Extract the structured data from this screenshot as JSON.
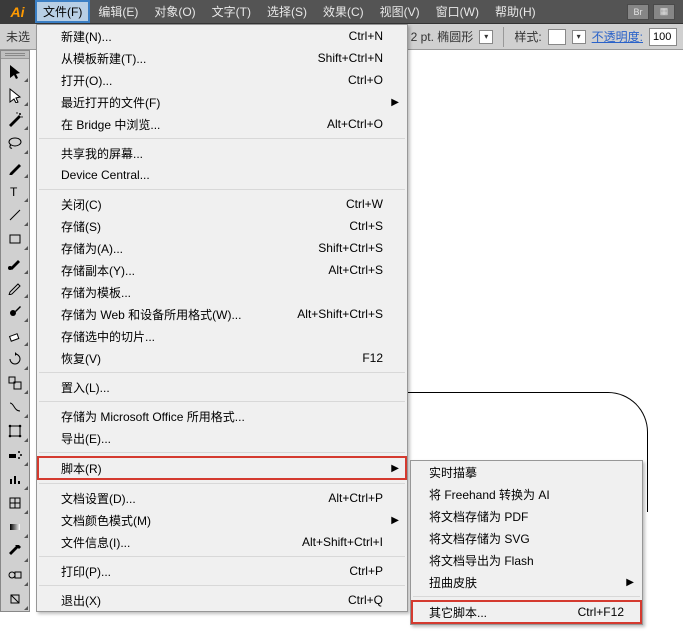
{
  "app": {
    "logo": "Ai",
    "badge1": "Br",
    "badge2": "▦"
  },
  "menubar": [
    "文件(F)",
    "编辑(E)",
    "对象(O)",
    "文字(T)",
    "选择(S)",
    "效果(C)",
    "视图(V)",
    "窗口(W)",
    "帮助(H)"
  ],
  "optbar": {
    "left_text": "未选",
    "stroke_label": "2 pt. 椭圆形",
    "style_label": "样式:",
    "opacity_label": "不透明度:",
    "opacity_value": "100"
  },
  "file_menu": [
    {
      "label": "新建(N)...",
      "shortcut": "Ctrl+N"
    },
    {
      "label": "从模板新建(T)...",
      "shortcut": "Shift+Ctrl+N"
    },
    {
      "label": "打开(O)...",
      "shortcut": "Ctrl+O"
    },
    {
      "label": "最近打开的文件(F)",
      "arrow": true
    },
    {
      "label": "在 Bridge 中浏览...",
      "shortcut": "Alt+Ctrl+O"
    },
    {
      "sep": true
    },
    {
      "label": "共享我的屏幕..."
    },
    {
      "label": "Device Central..."
    },
    {
      "sep": true
    },
    {
      "label": "关闭(C)",
      "shortcut": "Ctrl+W"
    },
    {
      "label": "存储(S)",
      "shortcut": "Ctrl+S"
    },
    {
      "label": "存储为(A)...",
      "shortcut": "Shift+Ctrl+S"
    },
    {
      "label": "存储副本(Y)...",
      "shortcut": "Alt+Ctrl+S"
    },
    {
      "label": "存储为模板..."
    },
    {
      "label": "存储为 Web 和设备所用格式(W)...",
      "shortcut": "Alt+Shift+Ctrl+S"
    },
    {
      "label": "存储选中的切片..."
    },
    {
      "label": "恢复(V)",
      "shortcut": "F12"
    },
    {
      "sep": true
    },
    {
      "label": "置入(L)..."
    },
    {
      "sep": true
    },
    {
      "label": "存储为 Microsoft Office 所用格式..."
    },
    {
      "label": "导出(E)..."
    },
    {
      "sep": true
    },
    {
      "label": "脚本(R)",
      "arrow": true,
      "hl": true
    },
    {
      "sep": true
    },
    {
      "label": "文档设置(D)...",
      "shortcut": "Alt+Ctrl+P"
    },
    {
      "label": "文档颜色模式(M)",
      "arrow": true
    },
    {
      "label": "文件信息(I)...",
      "shortcut": "Alt+Shift+Ctrl+I"
    },
    {
      "sep": true
    },
    {
      "label": "打印(P)...",
      "shortcut": "Ctrl+P"
    },
    {
      "sep": true
    },
    {
      "label": "退出(X)",
      "shortcut": "Ctrl+Q"
    }
  ],
  "script_submenu": [
    {
      "label": "实时描摹"
    },
    {
      "label": "将 Freehand 转换为 AI"
    },
    {
      "label": "将文档存储为 PDF"
    },
    {
      "label": "将文档存储为 SVG"
    },
    {
      "label": "将文档导出为 Flash"
    },
    {
      "label": "扭曲皮肤",
      "arrow": true
    },
    {
      "sep": true
    },
    {
      "label": "其它脚本...",
      "shortcut": "Ctrl+F12",
      "hl": true
    }
  ],
  "tools": [
    "selection",
    "direct-selection",
    "magic-wand",
    "lasso",
    "pen",
    "type",
    "line",
    "rectangle",
    "paintbrush",
    "pencil",
    "blob-brush",
    "eraser",
    "rotate",
    "scale",
    "warp",
    "free-transform",
    "symbol-sprayer",
    "graph",
    "mesh",
    "gradient",
    "eyedropper",
    "blend",
    "live-paint",
    "slice",
    "scissors",
    "hand",
    "zoom"
  ]
}
